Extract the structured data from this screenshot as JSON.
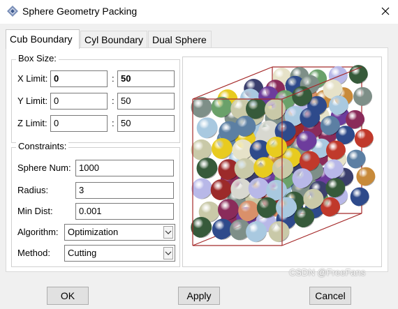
{
  "window": {
    "title": "Sphere Geometry Packing"
  },
  "tabs": [
    {
      "label": "Cub Boundary",
      "active": true
    },
    {
      "label": "Cyl Boundary",
      "active": false
    },
    {
      "label": "Dual Sphere",
      "active": false
    }
  ],
  "box_size": {
    "title": "Box Size:",
    "rows": [
      {
        "label": "X Limit:",
        "min": "0",
        "max": "50"
      },
      {
        "label": "Y Limit:",
        "min": "0",
        "max": "50"
      },
      {
        "label": "Z Limit:",
        "min": "0",
        "max": "50"
      }
    ],
    "separator": ":"
  },
  "constraints": {
    "title": "Constraints:",
    "sphere_num": {
      "label": "Sphere Num:",
      "value": "1000"
    },
    "radius": {
      "label": "Radius:",
      "value": "3"
    },
    "min_dist": {
      "label": "Min Dist:",
      "value": "0.001"
    },
    "algorithm": {
      "label": "Algorithm:",
      "value": "Optimization"
    },
    "method": {
      "label": "Method:",
      "value": "Cutting"
    }
  },
  "buttons": {
    "ok": "OK",
    "apply": "Apply",
    "cancel": "Cancel"
  },
  "watermark": "CSDN @FreeFans",
  "colors": {
    "box_edge": "#a52a2a",
    "spheres": [
      "#2e4a8b",
      "#c9c9a8",
      "#e6e2c8",
      "#d9906a",
      "#8a2b5a",
      "#e8cb1f",
      "#6d3c9c",
      "#a9c9e0",
      "#365a3a",
      "#7e8f88",
      "#6aa16a",
      "#c0392b",
      "#3b3f6d",
      "#d8d8d0",
      "#b8b8e8",
      "#5c7fa3",
      "#9c2a2a",
      "#c88a3a"
    ]
  }
}
